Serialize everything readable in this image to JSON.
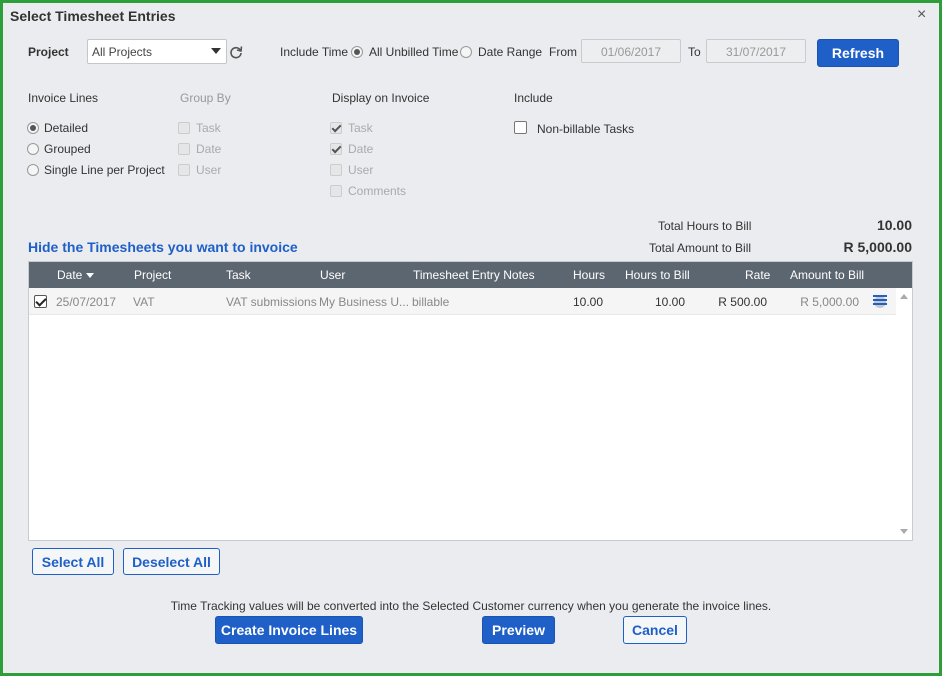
{
  "dialog": {
    "title": "Select Timesheet Entries",
    "close_glyph": "×"
  },
  "filters": {
    "project_label": "Project",
    "project_value": "All Projects",
    "include_time_label": "Include Time",
    "all_unbilled_label": "All Unbilled Time",
    "date_range_label": "Date Range",
    "from_label": "From",
    "from_value": "01/06/2017",
    "to_label": "To",
    "to_value": "31/07/2017",
    "refresh_label": "Refresh",
    "selected_include_time": "All Unbilled Time"
  },
  "invoice_lines": {
    "heading": "Invoice Lines",
    "options": [
      "Detailed",
      "Grouped",
      "Single Line per Project"
    ],
    "selected": "Detailed"
  },
  "group_by": {
    "heading": "Group By",
    "options": [
      {
        "label": "Task",
        "checked": false,
        "disabled": true
      },
      {
        "label": "Date",
        "checked": false,
        "disabled": true
      },
      {
        "label": "User",
        "checked": false,
        "disabled": true
      }
    ]
  },
  "display_on_invoice": {
    "heading": "Display on Invoice",
    "options": [
      {
        "label": "Task",
        "checked": true,
        "disabled": true
      },
      {
        "label": "Date",
        "checked": true,
        "disabled": true
      },
      {
        "label": "User",
        "checked": false,
        "disabled": true
      },
      {
        "label": "Comments",
        "checked": false,
        "disabled": true
      }
    ]
  },
  "include": {
    "heading": "Include",
    "non_billable_label": "Non-billable Tasks",
    "non_billable_checked": false
  },
  "totals": {
    "hours_label": "Total Hours to Bill",
    "hours_value": "10.00",
    "amount_label": "Total Amount to Bill",
    "amount_value": "R 5,000.00"
  },
  "section_title": "Hide the Timesheets you want to invoice",
  "table": {
    "columns": [
      "Date",
      "Project",
      "Task",
      "User",
      "Timesheet Entry Notes",
      "Hours",
      "Hours to Bill",
      "Rate",
      "Amount to Bill"
    ],
    "sorted_column": "Date",
    "rows": [
      {
        "selected": true,
        "date": "25/07/2017",
        "project": "VAT",
        "task": "VAT submissions",
        "user": "My Business U...",
        "notes": "billable",
        "hours": "10.00",
        "hours_to_bill": "10.00",
        "rate": "R 500.00",
        "amount": "R 5,000.00"
      }
    ]
  },
  "selection_buttons": {
    "select_all": "Select All",
    "deselect_all": "Deselect All"
  },
  "footer": {
    "note": "Time Tracking values will be converted into the Selected Customer currency when you generate the invoice lines.",
    "create_label": "Create Invoice Lines",
    "preview_label": "Preview",
    "cancel_label": "Cancel"
  },
  "colors": {
    "primary": "#1f5fc8",
    "frame": "#2e9e3a",
    "header_bg": "#5c6670"
  }
}
